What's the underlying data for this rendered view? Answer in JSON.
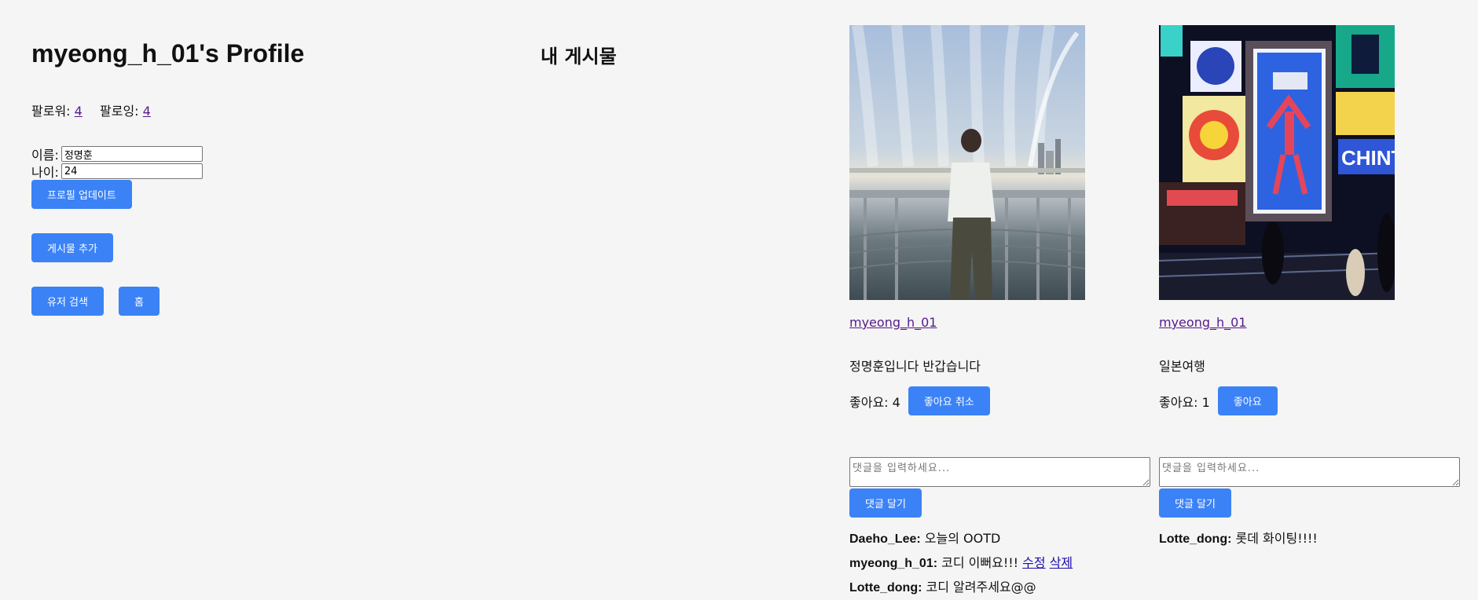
{
  "profile": {
    "title": "myeong_h_01's Profile",
    "followers_label": "팔로워: ",
    "followers_count": "4",
    "following_label": "팔로잉: ",
    "following_count": "4",
    "name_label": "이름: ",
    "name_value": "정명훈",
    "age_label": "나이: ",
    "age_value": "24",
    "update_button": "프로필 업데이트",
    "add_post_button": "게시물 추가",
    "search_user_button": "유저 검색",
    "home_button": "홈"
  },
  "posts_title": "내 게시물",
  "posts": [
    {
      "author": "myeong_h_01",
      "caption": "정명훈입니다 반갑습니다",
      "likes_label": "좋아요: 4",
      "like_button": "좋아요 취소",
      "comment_placeholder": "댓글을 입력하세요...",
      "comment_button": "댓글 달기",
      "comments": [
        {
          "user": "Daeho_Lee:",
          "text": " 오늘의 OOTD",
          "edit": "",
          "delete": ""
        },
        {
          "user": "myeong_h_01:",
          "text": " 코디 이뻐요!!! ",
          "edit": "수정",
          "delete": "삭제"
        },
        {
          "user": "Lotte_dong:",
          "text": " 코디 알려주세요@@",
          "edit": "",
          "delete": ""
        }
      ]
    },
    {
      "author": "myeong_h_01",
      "caption": "일본여행",
      "likes_label": "좋아요: 1",
      "like_button": "좋아요",
      "comment_placeholder": "댓글을 입력하세요...",
      "comment_button": "댓글 달기",
      "comments": [
        {
          "user": "Lotte_dong:",
          "text": " 롯데 화이팅!!!!"
        }
      ]
    }
  ],
  "colors": {
    "button": "#3b82f6",
    "background": "#f5f5f5"
  }
}
